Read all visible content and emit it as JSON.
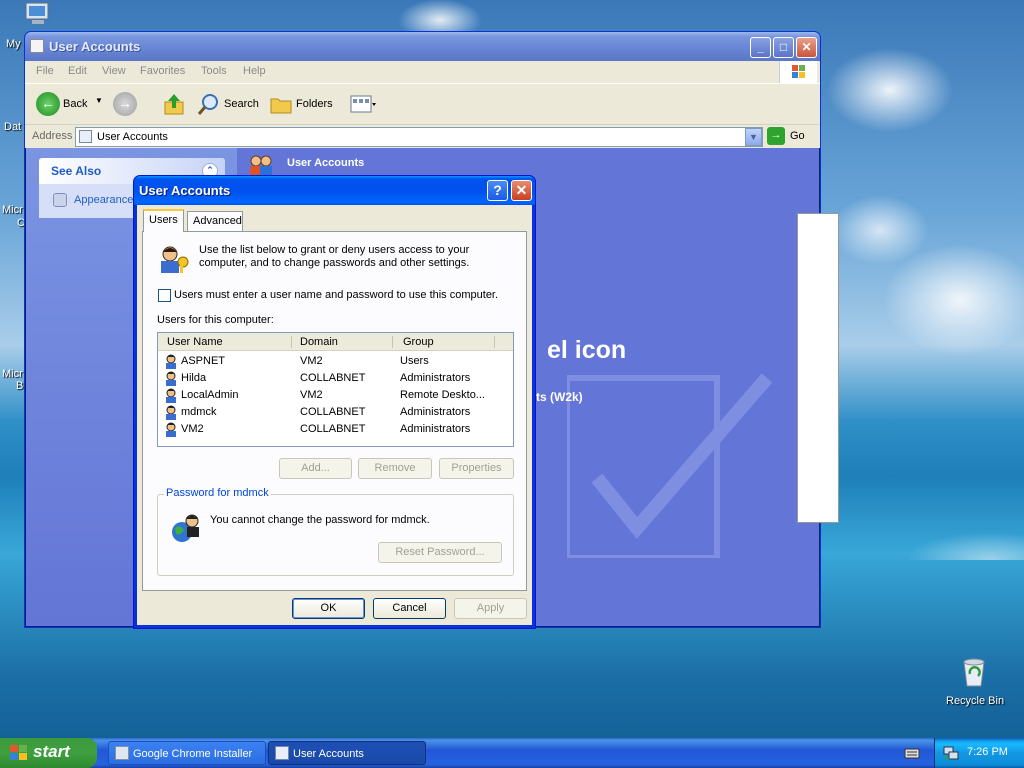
{
  "desktop": {
    "labels": [
      "My",
      "Dat",
      "Micr",
      "C",
      "Micr",
      "B"
    ],
    "recycle_bin": "Recycle Bin"
  },
  "explorer": {
    "title": "User Accounts",
    "menu": [
      "File",
      "Edit",
      "View",
      "Favorites",
      "Tools",
      "Help"
    ],
    "toolbar": {
      "back": "Back",
      "search": "Search",
      "folders": "Folders"
    },
    "address_label": "Address",
    "address_value": "User Accounts",
    "go": "Go",
    "see_also": {
      "title": "See Also",
      "item": "Appearance"
    },
    "right_header": "User Accounts",
    "bg_text_large": "el icon",
    "bg_text_small": "ts (W2k)"
  },
  "dialog": {
    "title": "User Accounts",
    "help_button": "?",
    "tabs": [
      "Users",
      "Advanced"
    ],
    "intro": "Use the list below to grant or deny users access to your computer, and to change passwords and other settings.",
    "checkbox_label": "Users must enter a user name and password to use this computer.",
    "checkbox_checked": false,
    "users_label": "Users for this computer:",
    "columns": [
      "User Name",
      "Domain",
      "Group"
    ],
    "users": [
      {
        "name": "ASPNET",
        "domain": "VM2",
        "group": "Users"
      },
      {
        "name": "Hilda",
        "domain": "COLLABNET",
        "group": "Administrators"
      },
      {
        "name": "LocalAdmin",
        "domain": "VM2",
        "group": "Remote Deskto..."
      },
      {
        "name": "mdmck",
        "domain": "COLLABNET",
        "group": "Administrators"
      },
      {
        "name": "VM2",
        "domain": "COLLABNET",
        "group": "Administrators"
      }
    ],
    "buttons": {
      "add": "Add...",
      "remove": "Remove",
      "properties": "Properties"
    },
    "password_group_title": "Password for mdmck",
    "password_message": "You cannot change the password for mdmck.",
    "reset_password": "Reset Password...",
    "ok": "OK",
    "cancel": "Cancel",
    "apply": "Apply"
  },
  "taskbar": {
    "start": "start",
    "tasks": [
      "Google Chrome Installer",
      "User Accounts"
    ],
    "clock": "7:26 PM"
  }
}
